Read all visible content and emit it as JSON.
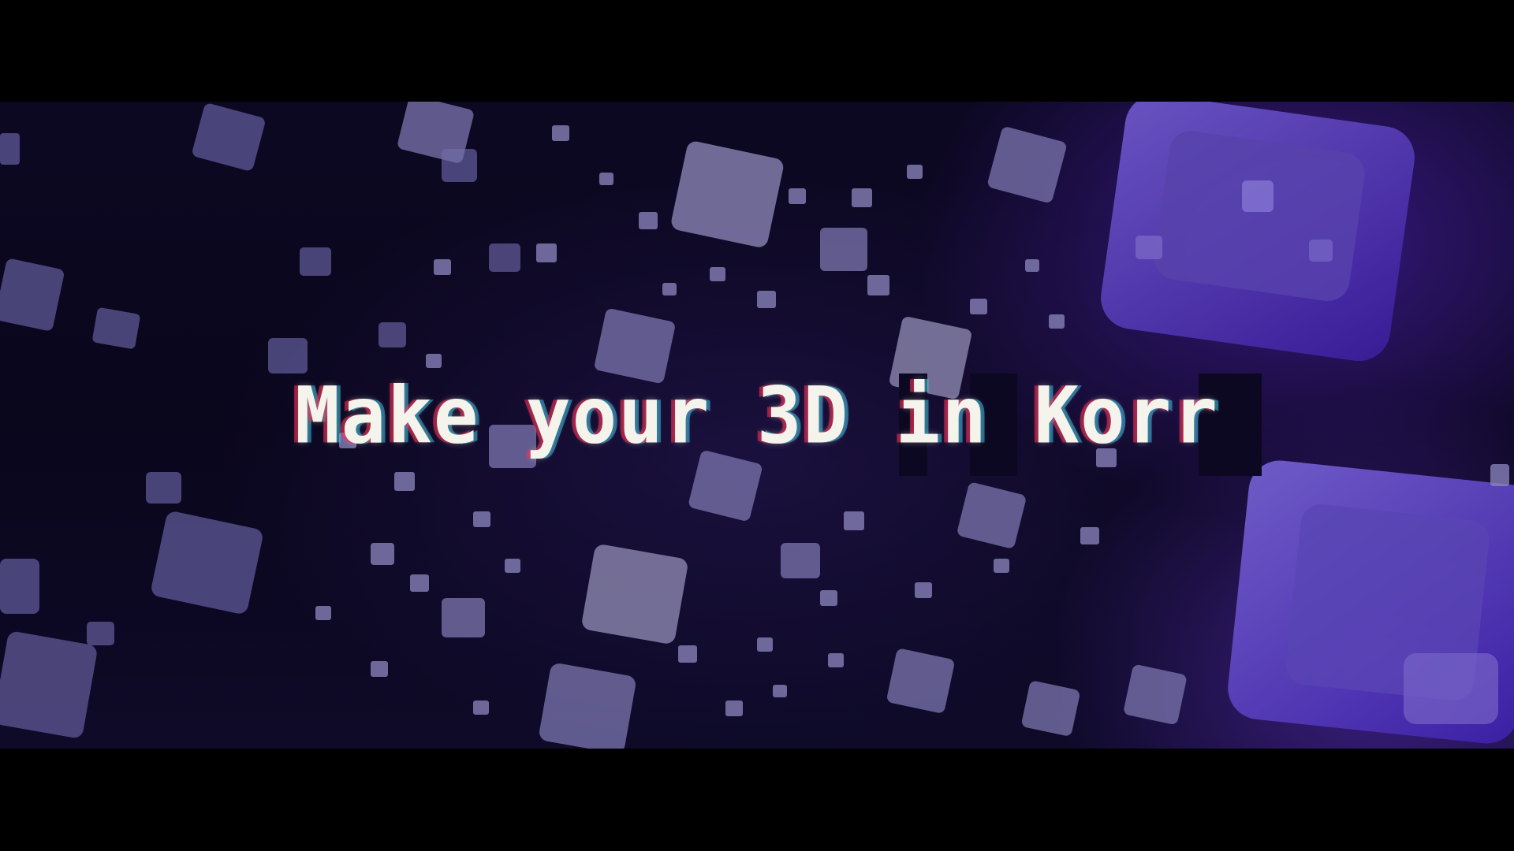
{
  "headline": "Make your 3D  in Korr",
  "colors": {
    "background": "#0a061c",
    "cube": "#6a5ea8",
    "cube_highlight": "#9a92c8",
    "text": "#f4f4ec",
    "accent_purple": "#4a22b8"
  }
}
